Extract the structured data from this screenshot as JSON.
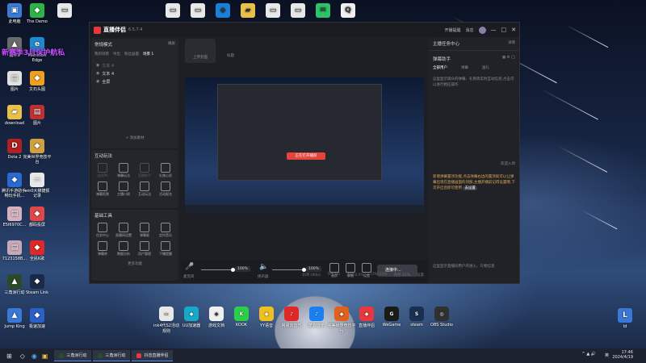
{
  "desktop": {
    "promo_text": "新赛季3月保护航私",
    "left_icons": [
      {
        "label": "此电脑",
        "icon": "computer-icon",
        "color": "#3a7bd5"
      },
      {
        "label": "The Demo",
        "icon": "app-icon",
        "color": "#2db34a"
      },
      {
        "label": "崩坏3",
        "icon": "game-icon",
        "color": "#6a6a6a"
      },
      {
        "label": "Microsoft Edge",
        "icon": "edge-icon",
        "color": "#1f8ad2"
      },
      {
        "label": "图片",
        "icon": "image-icon",
        "color": "#e0e0e0"
      },
      {
        "label": "文石头图",
        "icon": "app-icon",
        "color": "#f0a020"
      },
      {
        "label": "download",
        "icon": "folder-icon",
        "color": "#e8c04a"
      },
      {
        "label": "图片",
        "icon": "image-icon",
        "color": "#c03030"
      },
      {
        "label": "Dota 2",
        "icon": "dota-icon",
        "color": "#b02020"
      },
      {
        "label": "完美世界竞技平台",
        "icon": "app-icon",
        "color": "#d0a040"
      },
      {
        "label": "腾讯手游助手-畅玩手机...",
        "icon": "app-icon",
        "color": "#2a6ad0"
      },
      {
        "label": "em0大梯捷报记录",
        "icon": "doc-icon",
        "color": "#e8e8e8"
      },
      {
        "label": "E5I6970C...",
        "icon": "image-icon",
        "color": "#d8b0c0"
      },
      {
        "label": "都码投屏",
        "icon": "app-icon",
        "color": "#e04848"
      },
      {
        "label": "7123158B...",
        "icon": "image-icon",
        "color": "#c8a8b8"
      },
      {
        "label": "全民K歌",
        "icon": "app-icon",
        "color": "#e02828"
      },
      {
        "label": "三角洲行动",
        "icon": "game-icon",
        "color": "#2a4a2a"
      },
      {
        "label": "Steam Link",
        "icon": "app-icon",
        "color": "#1a2a48"
      },
      {
        "label": "Jump King",
        "icon": "game-icon",
        "color": "#3a78d8"
      },
      {
        "label": "极速加速",
        "icon": "app-icon",
        "color": "#2a60c8"
      }
    ],
    "top_icons": [
      {
        "label": "",
        "icon": "doc-icon",
        "color": "#e8e8e8"
      },
      {
        "label": "",
        "icon": "doc-icon",
        "color": "#e8e8e8"
      },
      {
        "label": "",
        "icon": "doc-icon",
        "color": "#e8e8e8"
      },
      {
        "label": "",
        "icon": "app-icon",
        "color": "#1a80d8"
      },
      {
        "label": "",
        "icon": "folder-icon",
        "color": "#e8c04a"
      },
      {
        "label": "",
        "icon": "doc-icon",
        "color": "#e8e8e8"
      },
      {
        "label": "",
        "icon": "doc-icon",
        "color": "#e8e8e8"
      },
      {
        "label": "",
        "icon": "wechat-icon",
        "color": "#2dc36a"
      },
      {
        "label": "",
        "icon": "qq-icon",
        "color": "#f0f0f0"
      }
    ],
    "bottom_icons": [
      {
        "label": "ink4代S2活动规则",
        "icon": "doc-icon",
        "color": "#e8e8e8"
      },
      {
        "label": "UU加速器",
        "icon": "app-icon",
        "color": "#18a8c8"
      },
      {
        "label": "游戏文档",
        "icon": "app-icon",
        "color": "#f0f0f0"
      },
      {
        "label": "KOOK",
        "icon": "kook-icon",
        "color": "#2ad04a"
      },
      {
        "label": "YY语音",
        "icon": "app-icon",
        "color": "#f0c020"
      },
      {
        "label": "网易云音乐",
        "icon": "music-icon",
        "color": "#e02828"
      },
      {
        "label": "酷狗音乐",
        "icon": "music-icon",
        "color": "#1a80f0"
      },
      {
        "label": "完美世界竞技平台",
        "icon": "app-icon",
        "color": "#e06020"
      },
      {
        "label": "直播伴侣",
        "icon": "app-icon",
        "color": "#e8383d"
      },
      {
        "label": "WeGame",
        "icon": "wegame-icon",
        "color": "#1a1a1a"
      },
      {
        "label": "steam",
        "icon": "steam-icon",
        "color": "#1a3050"
      },
      {
        "label": "OBS Studio",
        "icon": "obs-icon",
        "color": "#303030"
      }
    ],
    "right_icon": {
      "label": "ld",
      "icon": "app-icon",
      "color": "#3a78d8"
    }
  },
  "app": {
    "title": "直播伴侣",
    "version": "6.5.7.4",
    "titlebar": {
      "open_live": "开播提醒",
      "fans": "消息",
      "user": ""
    },
    "scenes": {
      "mode": "常规模式",
      "mode_right": "横屏",
      "tabs": [
        "我的场景",
        "导出",
        "粉丝画面",
        "场景 1"
      ],
      "items": [
        "文本 4",
        "文本 4",
        "全屏"
      ],
      "add_label": "+ 添加素材"
    },
    "interact": {
      "title": "互动玩法",
      "items": [
        "连线PK",
        "弹幕玩法",
        "直播助手",
        "礼物心愿",
        "弹幕投票",
        "主播口袋",
        "互动玩法",
        "活动报名"
      ]
    },
    "tools": {
      "title": "基础工具",
      "items": [
        "任务中心",
        "直播间设置",
        "弹幕姬",
        "定时音乐",
        "弹幕库",
        "数据分析",
        "用户管理",
        "下播提醒"
      ],
      "more": "更多功能"
    },
    "center": {
      "tabs": [
        "上传封面",
        "标题"
      ],
      "preview_button": "正在打开播屏",
      "controls": {
        "mic_label": "麦克风",
        "mic_value": "100%",
        "sys_label": "扬声器",
        "sys_value": "100%",
        "tools": [
          "画质",
          "录制",
          "设置"
        ],
        "start_label": "连接中..."
      },
      "status": [
        "码率:0Kb/s",
        "FPS:60",
        "丢帧:0.0%",
        "CPU:11%",
        "内存:31%",
        "设置"
      ]
    },
    "right": {
      "header": "主播任务中心",
      "header_link": "详情",
      "assistant_title": "弹幕助手",
      "tabs": [
        "全部用户",
        "弹幕",
        "送礼"
      ],
      "info_top": "这里显示观众的弹幕、礼物等实时互动信息,点击可以进行相应操作",
      "welcome": "欢迎入场",
      "notice": "新增弹幕置顶功能,点击弹幕右边的置顶就可以让弹幕出现在直播画面的顶部,主播开播前记得设置哦,下次开启后即可使用",
      "notice_link": "去设置",
      "info_bottom": "这里显示直播间用户的进入、礼物信息"
    }
  },
  "taskbar": {
    "tasks": [
      {
        "label": "三角洲行动"
      },
      {
        "label": "三角洲行动"
      },
      {
        "label": "抖音直播伴侣"
      }
    ],
    "time": "17:46",
    "date": "2024/4/19",
    "lang": "英"
  }
}
